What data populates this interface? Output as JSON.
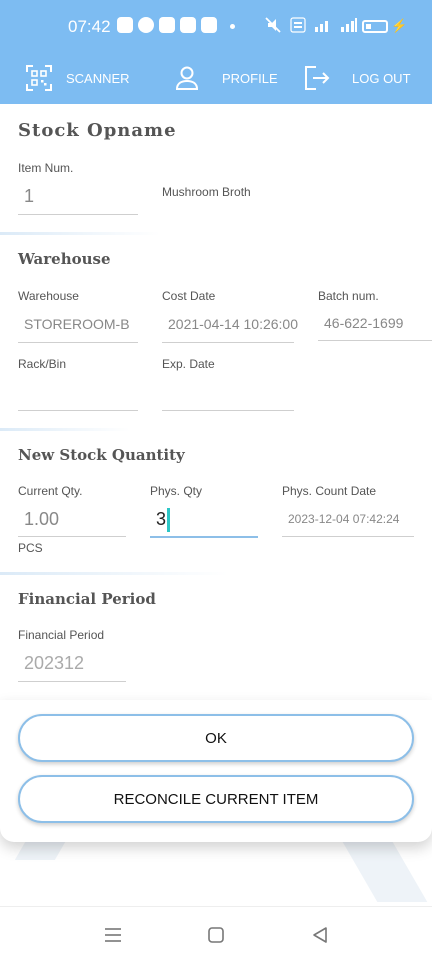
{
  "status": {
    "time": "07:42"
  },
  "app_bar": {
    "scanner_label": "SCANNER",
    "profile_label": "PROFILE",
    "logout_label": "LOG OUT"
  },
  "page": {
    "title": "Stock Opname",
    "item_num_label": "Item Num.",
    "item_num_value": "1",
    "item_name": "Mushroom Broth"
  },
  "warehouse": {
    "title": "Warehouse",
    "warehouse_label": "Warehouse",
    "warehouse_value": "STOREROOM-B",
    "cost_date_label": "Cost Date",
    "cost_date_value": "2021-04-14 10:26:00",
    "batch_label": "Batch num.",
    "batch_value": "46-622-1699",
    "rack_label": "Rack/Bin",
    "rack_value": "",
    "exp_label": "Exp. Date",
    "exp_value": ""
  },
  "stock": {
    "title": "New Stock Quantity",
    "current_label": "Current Qty.",
    "current_value": "1.00",
    "unit": "PCS",
    "phys_label": "Phys. Qty",
    "phys_value": "3",
    "count_date_label": "Phys. Count Date",
    "count_date_value": "2023-12-04 07:42:24"
  },
  "financial": {
    "title": "Financial Period",
    "period_label": "Financial Period",
    "period_value": "202312"
  },
  "actions": {
    "ok_label": "OK",
    "reconcile_label": "RECONCILE CURRENT ITEM"
  },
  "colors": {
    "accent": "#7dbcf2",
    "caret": "#2cc6c6",
    "button_border": "#8dbfe8"
  }
}
